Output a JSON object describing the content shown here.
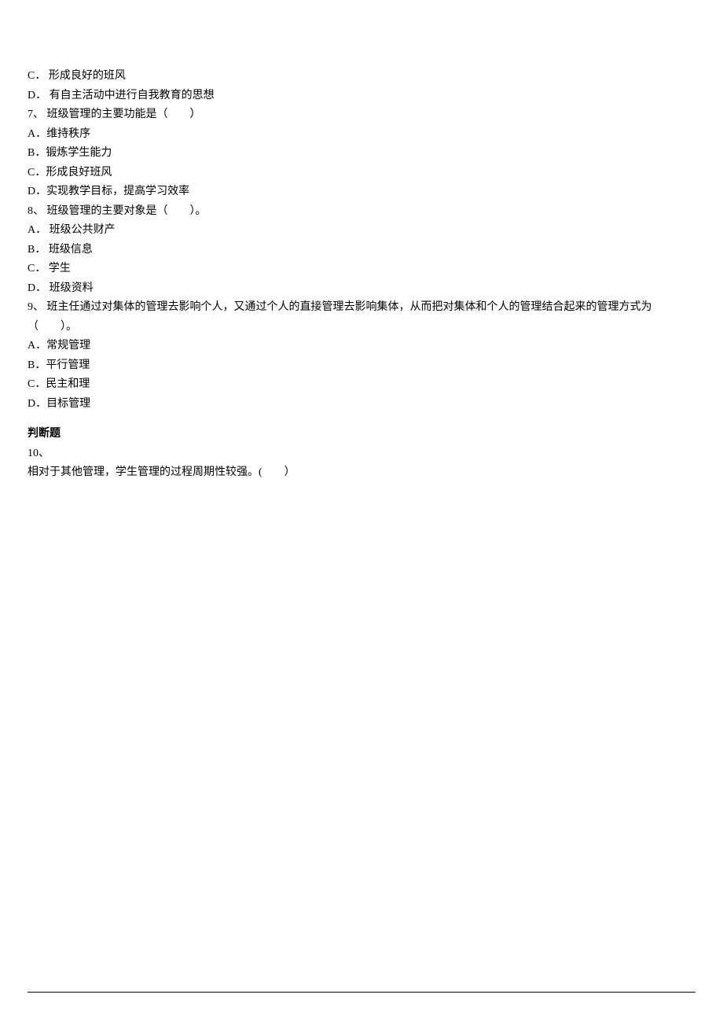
{
  "lines": {
    "q6_C": "C．  形成良好的班风",
    "q6_D": "D．  有自主活动中进行自我教育的思想",
    "q7_stem": "7、 班级管理的主要功能是（　　）",
    "q7_A": "A．维持秩序",
    "q7_B": "B．锻炼学生能力",
    "q7_C": "C．形成良好班风",
    "q7_D": "D．实现教学目标，提高学习效率",
    "q8_stem": "8、 班级管理的主要对象是（　　）。",
    "q8_A": "A．  班级公共财产",
    "q8_B": "B．  班级信息",
    "q8_C": "C．  学生",
    "q8_D": "D．  班级资料",
    "q9_stem": "9、 班主任通过对集体的管理去影响个人，又通过个人的直接管理去影响集体，从而把对集体和个人的管理结合起来的管理方式为（　　）。",
    "q9_A": "A．常规管理",
    "q9_B": "B．平行管理",
    "q9_C": "C．民主和理",
    "q9_D": "D．目标管理",
    "judge_title": "判断题",
    "q10_num": "10、",
    "q10_stem": "相对于其他管理，学生管理的过程周期性较强。(　　）"
  }
}
